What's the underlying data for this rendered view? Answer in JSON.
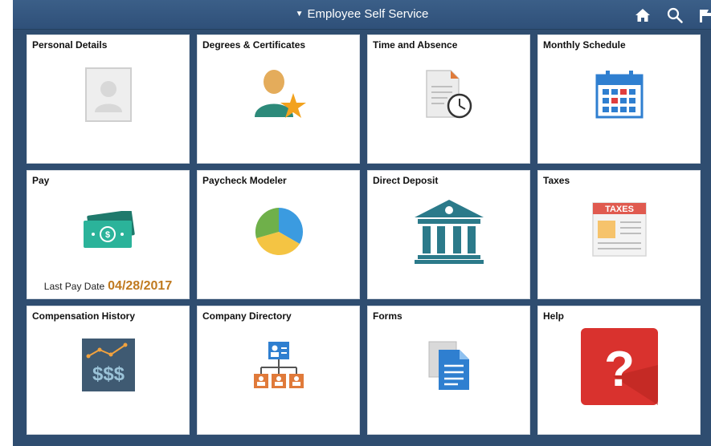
{
  "header": {
    "title": "Employee Self Service",
    "title_caret": "▼"
  },
  "tiles": [
    {
      "label": "Personal Details"
    },
    {
      "label": "Degrees & Certificates"
    },
    {
      "label": "Time and Absence"
    },
    {
      "label": "Monthly Schedule"
    },
    {
      "label": "Pay",
      "last_pay_label": "Last Pay Date",
      "last_pay_date": "04/28/2017"
    },
    {
      "label": "Paycheck Modeler"
    },
    {
      "label": "Direct Deposit"
    },
    {
      "label": "Taxes",
      "icon_text": "TAXES"
    },
    {
      "label": "Compensation History",
      "icon_text": "$$$"
    },
    {
      "label": "Company Directory"
    },
    {
      "label": "Forms"
    },
    {
      "label": "Help",
      "icon_text": "?"
    }
  ],
  "colors": {
    "header_bg": "#2f5079",
    "page_bg": "#2f4d70",
    "date_accent": "#c07a20",
    "help_red": "#d9322e"
  }
}
